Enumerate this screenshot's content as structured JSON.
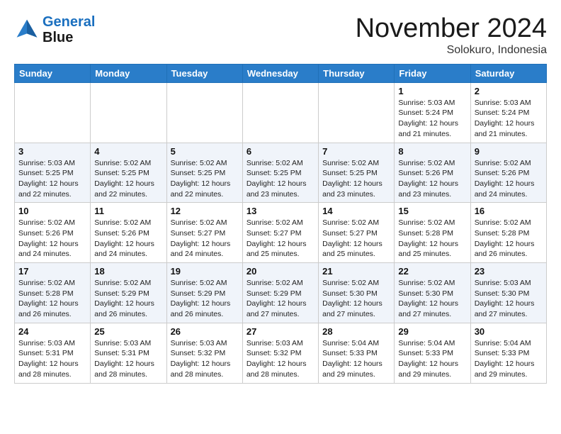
{
  "header": {
    "logo_line1": "General",
    "logo_line2": "Blue",
    "month_title": "November 2024",
    "location": "Solokuro, Indonesia"
  },
  "weekdays": [
    "Sunday",
    "Monday",
    "Tuesday",
    "Wednesday",
    "Thursday",
    "Friday",
    "Saturday"
  ],
  "weeks": [
    [
      {
        "day": "",
        "info": ""
      },
      {
        "day": "",
        "info": ""
      },
      {
        "day": "",
        "info": ""
      },
      {
        "day": "",
        "info": ""
      },
      {
        "day": "",
        "info": ""
      },
      {
        "day": "1",
        "info": "Sunrise: 5:03 AM\nSunset: 5:24 PM\nDaylight: 12 hours\nand 21 minutes."
      },
      {
        "day": "2",
        "info": "Sunrise: 5:03 AM\nSunset: 5:24 PM\nDaylight: 12 hours\nand 21 minutes."
      }
    ],
    [
      {
        "day": "3",
        "info": "Sunrise: 5:03 AM\nSunset: 5:25 PM\nDaylight: 12 hours\nand 22 minutes."
      },
      {
        "day": "4",
        "info": "Sunrise: 5:02 AM\nSunset: 5:25 PM\nDaylight: 12 hours\nand 22 minutes."
      },
      {
        "day": "5",
        "info": "Sunrise: 5:02 AM\nSunset: 5:25 PM\nDaylight: 12 hours\nand 22 minutes."
      },
      {
        "day": "6",
        "info": "Sunrise: 5:02 AM\nSunset: 5:25 PM\nDaylight: 12 hours\nand 23 minutes."
      },
      {
        "day": "7",
        "info": "Sunrise: 5:02 AM\nSunset: 5:25 PM\nDaylight: 12 hours\nand 23 minutes."
      },
      {
        "day": "8",
        "info": "Sunrise: 5:02 AM\nSunset: 5:26 PM\nDaylight: 12 hours\nand 23 minutes."
      },
      {
        "day": "9",
        "info": "Sunrise: 5:02 AM\nSunset: 5:26 PM\nDaylight: 12 hours\nand 24 minutes."
      }
    ],
    [
      {
        "day": "10",
        "info": "Sunrise: 5:02 AM\nSunset: 5:26 PM\nDaylight: 12 hours\nand 24 minutes."
      },
      {
        "day": "11",
        "info": "Sunrise: 5:02 AM\nSunset: 5:26 PM\nDaylight: 12 hours\nand 24 minutes."
      },
      {
        "day": "12",
        "info": "Sunrise: 5:02 AM\nSunset: 5:27 PM\nDaylight: 12 hours\nand 24 minutes."
      },
      {
        "day": "13",
        "info": "Sunrise: 5:02 AM\nSunset: 5:27 PM\nDaylight: 12 hours\nand 25 minutes."
      },
      {
        "day": "14",
        "info": "Sunrise: 5:02 AM\nSunset: 5:27 PM\nDaylight: 12 hours\nand 25 minutes."
      },
      {
        "day": "15",
        "info": "Sunrise: 5:02 AM\nSunset: 5:28 PM\nDaylight: 12 hours\nand 25 minutes."
      },
      {
        "day": "16",
        "info": "Sunrise: 5:02 AM\nSunset: 5:28 PM\nDaylight: 12 hours\nand 26 minutes."
      }
    ],
    [
      {
        "day": "17",
        "info": "Sunrise: 5:02 AM\nSunset: 5:28 PM\nDaylight: 12 hours\nand 26 minutes."
      },
      {
        "day": "18",
        "info": "Sunrise: 5:02 AM\nSunset: 5:29 PM\nDaylight: 12 hours\nand 26 minutes."
      },
      {
        "day": "19",
        "info": "Sunrise: 5:02 AM\nSunset: 5:29 PM\nDaylight: 12 hours\nand 26 minutes."
      },
      {
        "day": "20",
        "info": "Sunrise: 5:02 AM\nSunset: 5:29 PM\nDaylight: 12 hours\nand 27 minutes."
      },
      {
        "day": "21",
        "info": "Sunrise: 5:02 AM\nSunset: 5:30 PM\nDaylight: 12 hours\nand 27 minutes."
      },
      {
        "day": "22",
        "info": "Sunrise: 5:02 AM\nSunset: 5:30 PM\nDaylight: 12 hours\nand 27 minutes."
      },
      {
        "day": "23",
        "info": "Sunrise: 5:03 AM\nSunset: 5:30 PM\nDaylight: 12 hours\nand 27 minutes."
      }
    ],
    [
      {
        "day": "24",
        "info": "Sunrise: 5:03 AM\nSunset: 5:31 PM\nDaylight: 12 hours\nand 28 minutes."
      },
      {
        "day": "25",
        "info": "Sunrise: 5:03 AM\nSunset: 5:31 PM\nDaylight: 12 hours\nand 28 minutes."
      },
      {
        "day": "26",
        "info": "Sunrise: 5:03 AM\nSunset: 5:32 PM\nDaylight: 12 hours\nand 28 minutes."
      },
      {
        "day": "27",
        "info": "Sunrise: 5:03 AM\nSunset: 5:32 PM\nDaylight: 12 hours\nand 28 minutes."
      },
      {
        "day": "28",
        "info": "Sunrise: 5:04 AM\nSunset: 5:33 PM\nDaylight: 12 hours\nand 29 minutes."
      },
      {
        "day": "29",
        "info": "Sunrise: 5:04 AM\nSunset: 5:33 PM\nDaylight: 12 hours\nand 29 minutes."
      },
      {
        "day": "30",
        "info": "Sunrise: 5:04 AM\nSunset: 5:33 PM\nDaylight: 12 hours\nand 29 minutes."
      }
    ]
  ]
}
